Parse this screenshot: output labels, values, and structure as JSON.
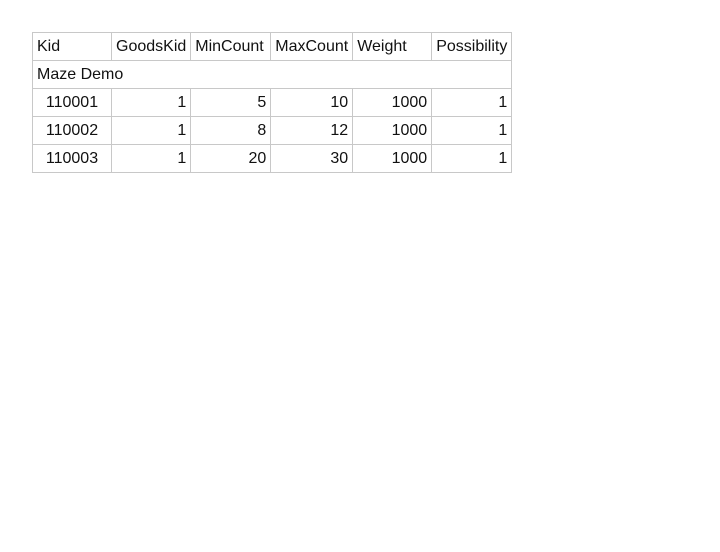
{
  "table": {
    "headers": [
      "Kid",
      "GoodsKid",
      "MinCount",
      "MaxCount",
      "Weight",
      "Possibility"
    ],
    "group_label": "Maze Demo",
    "rows": [
      [
        "110001",
        "1",
        "5",
        "10",
        "1000",
        "1"
      ],
      [
        "110002",
        "1",
        "8",
        "12",
        "1000",
        "1"
      ],
      [
        "110003",
        "1",
        "20",
        "30",
        "1000",
        "1"
      ]
    ]
  }
}
